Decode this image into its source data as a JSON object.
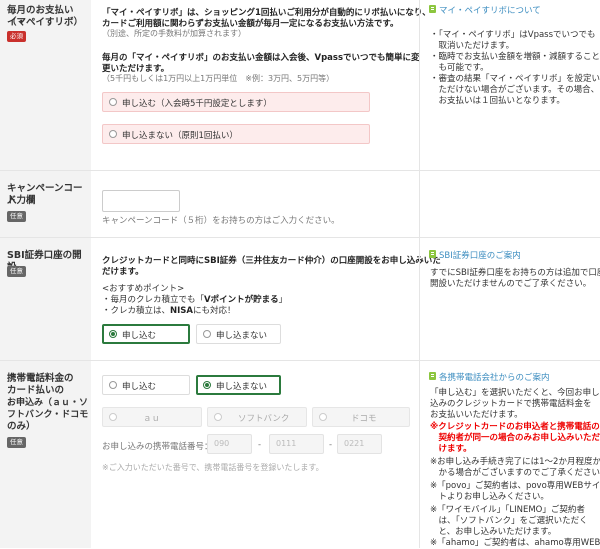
{
  "revo": {
    "label_l1": "毎月のお支払い（マ",
    "label_l2": "イ・ペイすリボ）",
    "badge": "必須",
    "desc1": "「マイ・ペイすリボ」は、ショッピング1回払いご利用分が自動的にリボ払いになり、",
    "desc2": "カードご利用額に関わらずお支払い金額が毎月一定になるお支払い方法です。",
    "desc3": "（別途、所定の手数料が加算されます）",
    "amount1": "毎月の「マイ・ペイすリボ」のお支払い金額は入会後、Vpassでいつでも簡単に変",
    "amount2": "更いただけます。",
    "amount_note": "（5千円もしくは1万円以上1万円単位　※例：3万円、5万円等）",
    "option_apply": "申し込む（入会時5千円設定とします）",
    "option_decline": "申し込まない（原則1回払い）",
    "side_link": "マイ・ペイすリボについて",
    "side_notes": [
      "・「マイ・ペイすリボ」はVpassでいつでも",
      "　取消いただけます。",
      "・臨時でお支払い金額を増額・減額すること",
      "　も可能です。",
      "・審査の結果「マイ・ペイすリボ」を設定い",
      "　ただけない場合がございます。その場合、",
      "　お支払いは１回払いとなります。"
    ]
  },
  "campaign": {
    "label_l1": "キャンペーンコード",
    "label_l2": "入力欄",
    "badge": "任意",
    "input_value": "",
    "hint": "キャンペーンコード（５桁）をお持ちの方はご入力ください。"
  },
  "sbi": {
    "label": "SBI証券口座の開設",
    "badge": "任意",
    "desc1": "クレジットカードと同時にSBI証券（三井住友カード仲介）の口座開設をお申し込みいた",
    "desc2": "だけます。",
    "rec_title": "<おすすめポイント>",
    "rec1_pre": "・毎月のクレカ積立でも「",
    "rec1_bold": "Vポイントが貯まる",
    "rec1_post": "」",
    "rec2_pre": "・クレカ積立は、",
    "rec2_bold": "NISA",
    "rec2_post": "にも対応！",
    "option_apply": "申し込む",
    "option_decline": "申し込まない",
    "side_link": "SBI証券口座のご案内",
    "side_note1": "すでにSBI証券口座をお持ちの方は追加で口座",
    "side_note2": "開設いただけませんのでご了承ください。"
  },
  "mobile": {
    "label_l1": "携帯電話料金の",
    "label_l2": "カード払いの",
    "label_l3": "お申込み（ａｕ・ソ",
    "label_l4": "フトバンク・ドコモ",
    "label_l5": "のみ）",
    "badge": "任意",
    "option_apply": "申し込む",
    "option_decline": "申し込まない",
    "carrier_au": "ａｕ",
    "carrier_softbank": "ソフトバンク",
    "carrier_docomo": "ドコモ",
    "phone_label": "お申し込みの携帯電話番号：",
    "phone_ph1": "090",
    "phone_ph2": "0111",
    "phone_ph3": "0221",
    "dash": "-",
    "hint": "※ご入力いただいた番号で、携帯電話番号を登録いたします。",
    "side_link": "各携帯電話会社からのご案内",
    "side_n1": "「申し込む」を選択いただくと、今回お申し",
    "side_n2": "込みのクレジットカードで携帯電話料金を",
    "side_n3": "お支払いいただけます。",
    "side_r1": "※クレジットカードのお申込者と携帯電話の",
    "side_r2": "　契約者が同一の場合のみお申し込みいただ",
    "side_r3": "　けます。",
    "side_a1": "※お申し込み手続き完了には1～2か月程度か",
    "side_a2": "　かる場合がございますのでご了承ください。",
    "side_b1": "※「povo」ご契約者は、povo専用WEBサイ",
    "side_b2": "　トよりお申し込みください。",
    "side_c1": "※「ワイモバイル」「LINEMO」ご契約者",
    "side_c2": "　は、「ソフトバンク」をご選択いただく",
    "side_c3": "　と、お申し込みいただけます。",
    "side_d1": "※「ahamo」ご契約者は、ahamo専用WEB",
    "side_d2": "　サイトよりお申し込みください。"
  }
}
